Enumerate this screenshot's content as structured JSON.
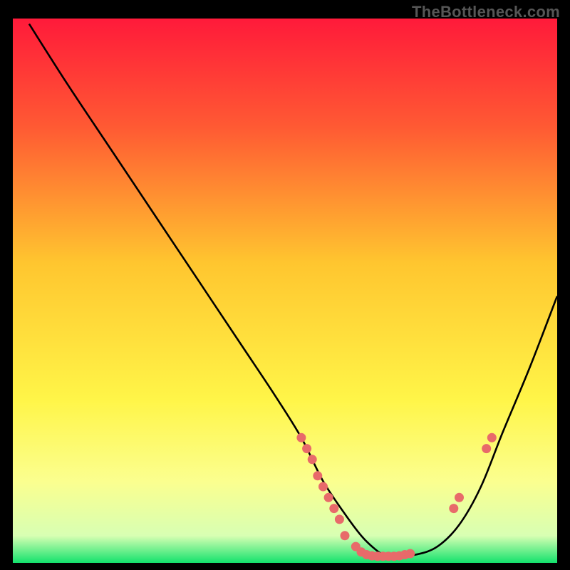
{
  "watermark": "TheBottleneck.com",
  "chart_data": {
    "type": "line",
    "title": "",
    "xlabel": "",
    "ylabel": "",
    "xlim": [
      0,
      100
    ],
    "ylim": [
      0,
      100
    ],
    "gradient_stops": [
      {
        "offset": 0,
        "color": "#ff1a3a"
      },
      {
        "offset": 20,
        "color": "#ff5a33"
      },
      {
        "offset": 45,
        "color": "#ffc62f"
      },
      {
        "offset": 70,
        "color": "#fff548"
      },
      {
        "offset": 85,
        "color": "#fbff8f"
      },
      {
        "offset": 95,
        "color": "#d8ffb3"
      },
      {
        "offset": 100,
        "color": "#14e26d"
      }
    ],
    "series": [
      {
        "name": "bottleneck-curve",
        "x": [
          3,
          10,
          18,
          26,
          34,
          42,
          48,
          53,
          57,
          61,
          64,
          66,
          68,
          70,
          74,
          78,
          82,
          86,
          90,
          95,
          100
        ],
        "y": [
          99,
          88,
          76,
          64,
          52,
          40,
          31,
          23,
          15,
          9,
          5,
          3,
          1.5,
          1.2,
          1.5,
          3,
          7,
          14,
          24,
          36,
          49
        ]
      }
    ],
    "markers": {
      "name": "data-points",
      "color": "#e86a6a",
      "points": [
        {
          "x": 53,
          "y": 23
        },
        {
          "x": 54,
          "y": 21
        },
        {
          "x": 55,
          "y": 19
        },
        {
          "x": 56,
          "y": 16
        },
        {
          "x": 57,
          "y": 14
        },
        {
          "x": 58,
          "y": 12
        },
        {
          "x": 59,
          "y": 10
        },
        {
          "x": 60,
          "y": 8
        },
        {
          "x": 61,
          "y": 5
        },
        {
          "x": 63,
          "y": 3
        },
        {
          "x": 64,
          "y": 2
        },
        {
          "x": 65,
          "y": 1.5
        },
        {
          "x": 66,
          "y": 1.3
        },
        {
          "x": 67,
          "y": 1.2
        },
        {
          "x": 68,
          "y": 1.2
        },
        {
          "x": 69,
          "y": 1.2
        },
        {
          "x": 70,
          "y": 1.2
        },
        {
          "x": 71,
          "y": 1.3
        },
        {
          "x": 72,
          "y": 1.5
        },
        {
          "x": 73,
          "y": 1.7
        },
        {
          "x": 81,
          "y": 10
        },
        {
          "x": 82,
          "y": 12
        },
        {
          "x": 87,
          "y": 21
        },
        {
          "x": 88,
          "y": 23
        }
      ]
    }
  }
}
